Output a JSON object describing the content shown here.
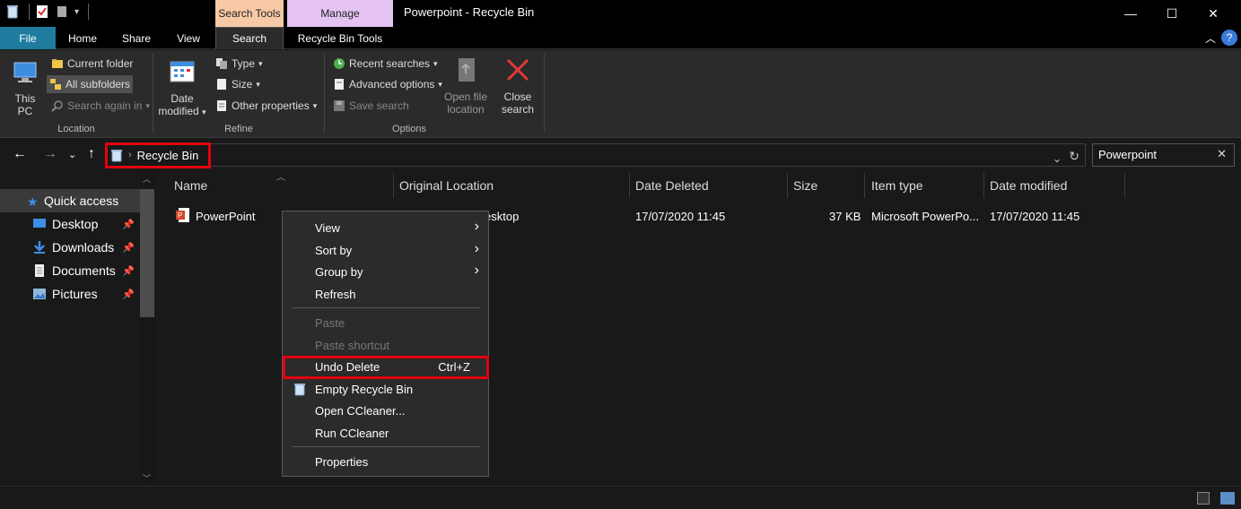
{
  "window": {
    "title": "Powerpoint - Recycle Bin",
    "context_tab_search": "Search Tools",
    "context_tab_manage": "Manage",
    "minimize": "—",
    "maximize": "☐",
    "close": "✕"
  },
  "tabs": {
    "file": "File",
    "home": "Home",
    "share": "Share",
    "view": "View",
    "search": "Search",
    "recycle_bin_tools": "Recycle Bin Tools",
    "help": "?"
  },
  "ribbon": {
    "location": {
      "label": "Location",
      "this_pc": "This PC",
      "current_folder": "Current folder",
      "all_subfolders": "All subfolders",
      "search_again_in": "Search again in"
    },
    "refine": {
      "label": "Refine",
      "date_modified_line1": "Date",
      "date_modified_line2": "modified",
      "type": "Type",
      "size": "Size",
      "other_properties": "Other properties"
    },
    "options": {
      "label": "Options",
      "recent_searches": "Recent searches",
      "advanced_options": "Advanced options",
      "save_search": "Save search",
      "open_file_location_line1": "Open file",
      "open_file_location_line2": "location",
      "close_search_line1": "Close",
      "close_search_line2": "search"
    }
  },
  "address": {
    "breadcrumb": "Recycle Bin",
    "search_value": "Powerpoint"
  },
  "nav": {
    "items": [
      {
        "label": "Quick access"
      },
      {
        "label": "Desktop"
      },
      {
        "label": "Downloads"
      },
      {
        "label": "Documents"
      },
      {
        "label": "Pictures"
      }
    ]
  },
  "columns": [
    "Name",
    "Original Location",
    "Date Deleted",
    "Size",
    "Item type",
    "Date modified"
  ],
  "rows": [
    {
      "name": "PowerPoint",
      "original_location": "esktop",
      "date_deleted": "17/07/2020 11:45",
      "size": "37 KB",
      "item_type": "Microsoft PowerPo...",
      "date_modified": "17/07/2020 11:45"
    }
  ],
  "context_menu": {
    "view": "View",
    "sort_by": "Sort by",
    "group_by": "Group by",
    "refresh": "Refresh",
    "paste": "Paste",
    "paste_shortcut": "Paste shortcut",
    "undo_delete": "Undo Delete",
    "undo_delete_shortcut": "Ctrl+Z",
    "empty_recycle_bin": "Empty Recycle Bin",
    "open_ccleaner": "Open CCleaner...",
    "run_ccleaner": "Run CCleaner",
    "properties": "Properties"
  },
  "colors": {
    "file_tab": "#1f7c9e",
    "search_tools_tab": "#f7c9a6",
    "manage_tab": "#e4c3f3",
    "highlight": "#e3000f",
    "help": "#3a7ad8"
  }
}
